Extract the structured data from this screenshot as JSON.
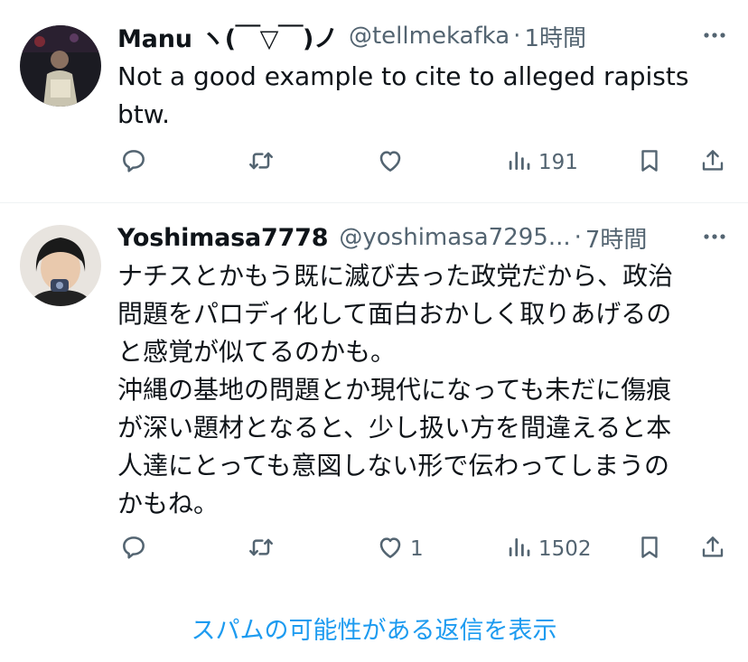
{
  "tweets": [
    {
      "name": "Manu ヽ(￣▽￣)ノ",
      "handle": "@tellmekafka",
      "separator": "·",
      "time": "1時間",
      "text": "Not a good example to cite to alleged rapists\nbtw.",
      "replies": "",
      "retweets": "",
      "likes": "",
      "views": "191"
    },
    {
      "name": "Yoshimasa7778",
      "handle": "@yoshimasa7295...",
      "separator": "·",
      "time": "7時間",
      "text": "ナチスとかもう既に滅び去った政党だから、政治\n問題をパロディ化して面白おかしく取りあげるの\nと感覚が似てるのかも。\n沖縄の基地の問題とか現代になっても未だに傷痕\nが深い題材となると、少し扱い方を間違えると本\n人達にとっても意図しない形で伝わってしまうの\nかもね。",
      "replies": "",
      "retweets": "",
      "likes": "1",
      "views": "1502"
    }
  ],
  "spam_link": "スパムの可能性がある返信を表示",
  "colors": {
    "text": "#0f1419",
    "secondary": "#536471",
    "accent": "#1d9bf0",
    "divider": "#eff3f4"
  },
  "icons": [
    "reply-icon",
    "retweet-icon",
    "like-icon",
    "views-icon",
    "bookmark-icon",
    "share-icon",
    "more-icon"
  ]
}
